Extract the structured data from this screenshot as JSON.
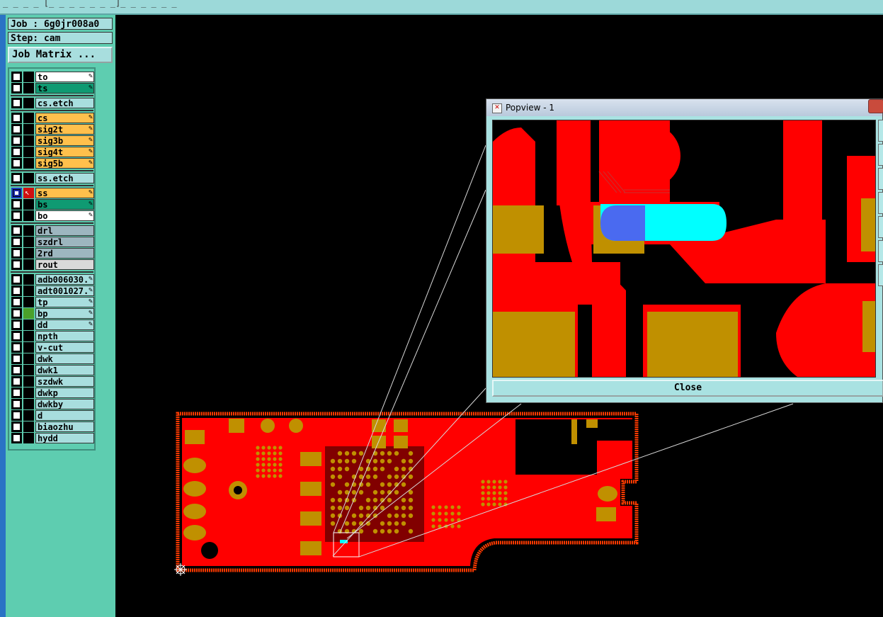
{
  "top_strip": {
    "text": "_ _ _  _ [_ _ _ _ _ _ _]_ _ _ _ _ _"
  },
  "job": {
    "label": "Job : 6g0jr008a0"
  },
  "step": {
    "label": "Step: cam"
  },
  "job_matrix_button": {
    "label": "Job Matrix ..."
  },
  "layers": [
    {
      "name": "to",
      "color": "#ffffff",
      "pen": true,
      "group": 1
    },
    {
      "name": "ts",
      "color": "#0f9a72",
      "pen": true,
      "group": 1
    },
    {
      "name": "cs.etch",
      "color": "#a8dede",
      "pen": false,
      "group": 2
    },
    {
      "name": "cs",
      "color": "#ffc04c",
      "pen": true,
      "group": 3
    },
    {
      "name": "sig2t",
      "color": "#ffc04c",
      "pen": true,
      "group": 3
    },
    {
      "name": "sig3b",
      "color": "#ffc04c",
      "pen": true,
      "group": 3
    },
    {
      "name": "sig4t",
      "color": "#ffc04c",
      "pen": true,
      "group": 3
    },
    {
      "name": "sig5b",
      "color": "#ffc04c",
      "pen": true,
      "group": 3
    },
    {
      "name": "ss.etch",
      "color": "#a8dede",
      "pen": false,
      "group": 4
    },
    {
      "name": "ss",
      "color": "#ffc04c",
      "pen": true,
      "group": 5,
      "active": true
    },
    {
      "name": "bs",
      "color": "#0f9a72",
      "pen": true,
      "group": 5
    },
    {
      "name": "bo",
      "color": "#ffffff",
      "pen": true,
      "group": 5
    },
    {
      "name": "drl",
      "color": "#9db6bf",
      "pen": false,
      "group": 6
    },
    {
      "name": "szdrl",
      "color": "#9db6bf",
      "pen": false,
      "group": 6
    },
    {
      "name": "2rd",
      "color": "#9db6bf",
      "pen": false,
      "group": 6
    },
    {
      "name": "rout",
      "color": "#d9d9d9",
      "pen": false,
      "group": 6
    },
    {
      "name": "adb006030.",
      "color": "#a8dede",
      "pen": true,
      "group": 7
    },
    {
      "name": "adt001027.",
      "color": "#a8dede",
      "pen": true,
      "group": 7
    },
    {
      "name": "tp",
      "color": "#a8dede",
      "pen": true,
      "group": 7
    },
    {
      "name": "bp",
      "color": "#a8dede",
      "pen": true,
      "group": 7,
      "mid_color": "#4aa02a"
    },
    {
      "name": "dd",
      "color": "#a8dede",
      "pen": true,
      "group": 7
    },
    {
      "name": "npth",
      "color": "#a8dede",
      "pen": false,
      "group": 7
    },
    {
      "name": "v-cut",
      "color": "#a8dede",
      "pen": false,
      "group": 7
    },
    {
      "name": "dwk",
      "color": "#a8dede",
      "pen": false,
      "group": 7
    },
    {
      "name": "dwk1",
      "color": "#a8dede",
      "pen": false,
      "group": 7
    },
    {
      "name": "szdwk",
      "color": "#a8dede",
      "pen": false,
      "group": 7
    },
    {
      "name": "dwkp",
      "color": "#a8dede",
      "pen": false,
      "group": 7
    },
    {
      "name": "dwkby",
      "color": "#a8dede",
      "pen": false,
      "group": 7
    },
    {
      "name": "d",
      "color": "#a8dede",
      "pen": false,
      "group": 7
    },
    {
      "name": "biaozhu",
      "color": "#a8dede",
      "pen": false,
      "group": 7
    },
    {
      "name": "hydd",
      "color": "#a8dede",
      "pen": false,
      "group": 7
    }
  ],
  "popview": {
    "title": "Popview - 1",
    "close_label": "Close"
  },
  "colors": {
    "copper": "#ff0000",
    "pad": "#c09000",
    "highlight_cyan": "#00ffff",
    "highlight_blue": "#4a6af0",
    "background": "#000000"
  }
}
